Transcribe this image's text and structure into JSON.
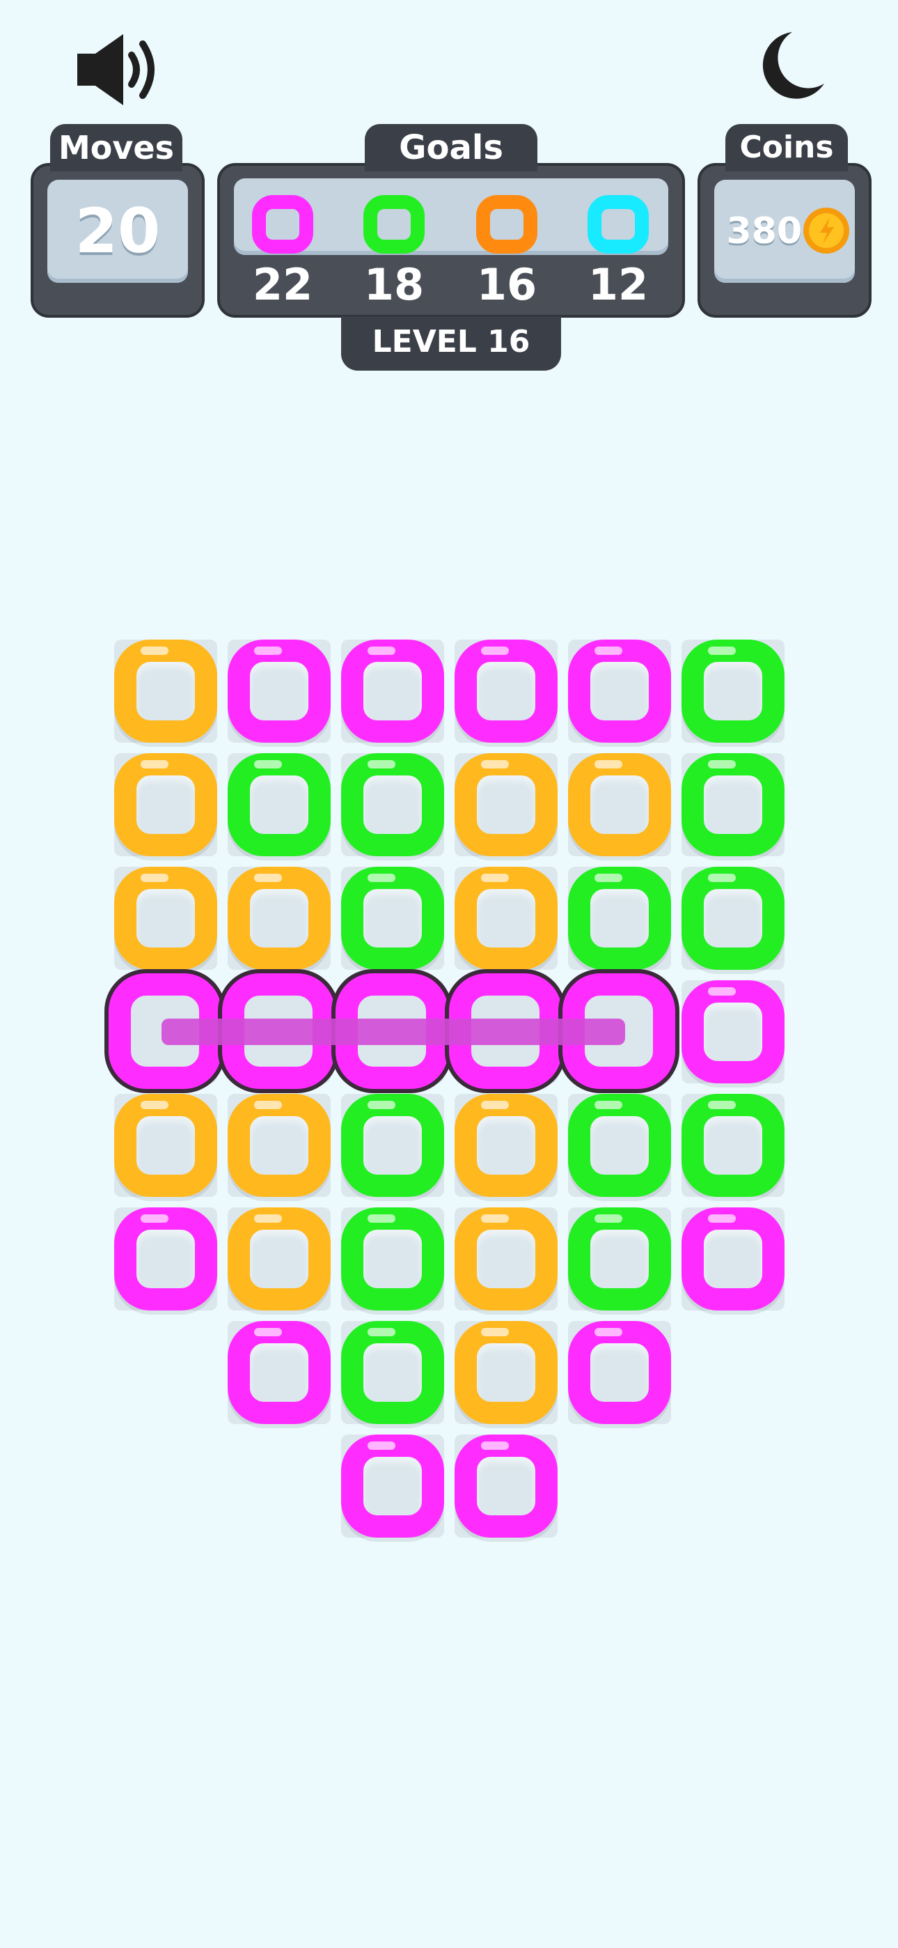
{
  "header": {
    "sound_icon": "speaker-icon",
    "theme_icon": "moon-icon",
    "moves": {
      "label": "Moves",
      "value": "20"
    },
    "goals": {
      "label": "Goals",
      "items": [
        {
          "color": "#ff2cff",
          "count": "22"
        },
        {
          "color": "#22ee22",
          "count": "18"
        },
        {
          "color": "#ff8a10",
          "count": "16"
        },
        {
          "color": "#18eaff",
          "count": "12"
        }
      ]
    },
    "level": "LEVEL 16",
    "coins": {
      "label": "Coins",
      "value": "380",
      "icon": "coin-icon"
    }
  },
  "board": {
    "colors": {
      "M": "#ff2cff",
      "G": "#22ee22",
      "Y": "#ffb81e"
    },
    "rows": [
      [
        "Y",
        "M",
        "M",
        "M",
        "M",
        "G"
      ],
      [
        "Y",
        "G",
        "G",
        "Y",
        "Y",
        "G"
      ],
      [
        "Y",
        "Y",
        "G",
        "Y",
        "G",
        "G"
      ],
      [
        "M",
        "M",
        "M",
        "M",
        "M",
        "M"
      ],
      [
        "Y",
        "Y",
        "G",
        "Y",
        "G",
        "G"
      ],
      [
        "M",
        "Y",
        "G",
        "Y",
        "G",
        "M"
      ],
      [
        "",
        "M",
        "G",
        "Y",
        "M",
        ""
      ],
      [
        "",
        "",
        "M",
        "M",
        "",
        ""
      ]
    ],
    "chained": {
      "row": 3,
      "cols": [
        0,
        1,
        2,
        3,
        4
      ]
    }
  }
}
